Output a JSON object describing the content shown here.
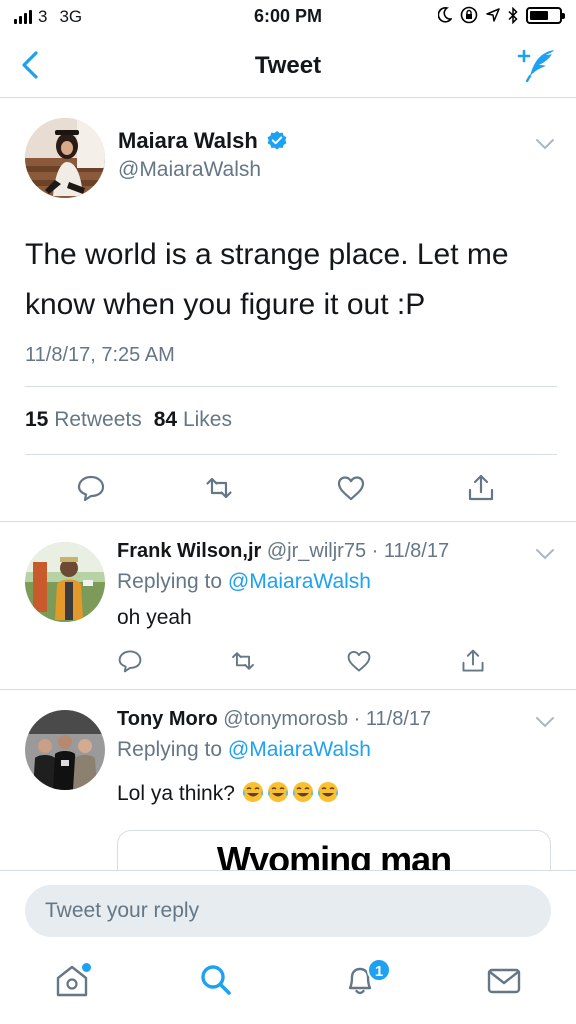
{
  "status_bar": {
    "carrier": "3",
    "network": "3G",
    "time": "6:00 PM"
  },
  "nav": {
    "title": "Tweet"
  },
  "main_tweet": {
    "name": "Maiara Walsh",
    "handle": "@MaiaraWalsh",
    "text": "The world is a strange place. Let me know when you figure it out :P",
    "date": "11/8/17, 7:25 AM",
    "retweets_count": "15",
    "retweets_label": "Retweets",
    "likes_count": "84",
    "likes_label": "Likes"
  },
  "replies": [
    {
      "name": "Frank Wilson,jr",
      "handle": "@jr_wiljr75",
      "date": "· 11/8/17",
      "replying_prefix": "Replying to",
      "replying_to": "@MaiaraWalsh",
      "text": "oh yeah"
    },
    {
      "name": "Tony Moro",
      "handle": "@tonymorosb",
      "date": "· 11/8/17",
      "replying_prefix": "Replying to",
      "replying_to": "@MaiaraWalsh",
      "text": "Lol ya think?",
      "card_text": "Wyoming man"
    }
  ],
  "composer": {
    "placeholder": "Tweet your reply"
  },
  "tabbar": {
    "notifications_badge": "1"
  },
  "colors": {
    "accent": "#1da1f2",
    "secondary_text": "#657786",
    "divider": "#d8dde1"
  }
}
